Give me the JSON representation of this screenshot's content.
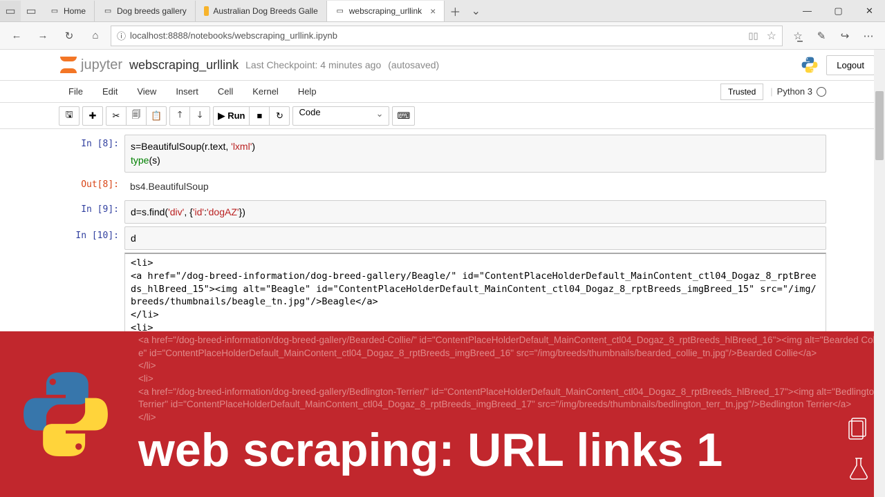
{
  "tabs": [
    {
      "label": "Home"
    },
    {
      "label": "Dog breeds gallery"
    },
    {
      "label": "Australian Dog Breeds Galle"
    },
    {
      "label": "webscraping_urllink",
      "active": true
    }
  ],
  "url": "localhost:8888/notebooks/webscraping_urllink.ipynb",
  "jupyter": {
    "logo_text": "jupyter",
    "notebook_name": "webscraping_urllink",
    "checkpoint": "Last Checkpoint: 4 minutes ago",
    "autosaved": "(autosaved)",
    "logout": "Logout",
    "trusted": "Trusted",
    "kernel": "Python 3"
  },
  "menu": [
    "File",
    "Edit",
    "View",
    "Insert",
    "Cell",
    "Kernel",
    "Help"
  ],
  "toolbar": {
    "run": "Run",
    "cell_type": "Code"
  },
  "cells": {
    "in8_prompt": "In [8]:",
    "in8_code_a": "s=BeautifulSoup(r.text, ",
    "in8_code_str": "'lxml'",
    "in8_code_b": ")\n",
    "in8_type": "type",
    "in8_paren": "(s)",
    "out8_prompt": "Out[8]:",
    "out8_val": "bs4.BeautifulSoup",
    "in9_prompt": "In [9]:",
    "in9_a": "d=s.find(",
    "in9_s1": "'div'",
    "in9_c": ", {",
    "in9_s2": "'id'",
    "in9_col": ":",
    "in9_s3": "'dogAZ'",
    "in9_e": "})",
    "in10_prompt": "In [10]:",
    "in10_code": "d",
    "out10_html": "<li>\n<a href=\"/dog-breed-information/dog-breed-gallery/Beagle/\" id=\"ContentPlaceHolderDefault_MainContent_ctl04_Dogaz_8_rptBreeds_hlBreed_15\"><img alt=\"Beagle\" id=\"ContentPlaceHolderDefault_MainContent_ctl04_Dogaz_8_rptBreeds_imgBreed_15\" src=\"/img/breeds/thumbnails/beagle_tn.jpg\"/>Beagle</a>\n</li>\n<li>"
  },
  "banner": {
    "code": "<a href=\"/dog-breed-information/dog-breed-gallery/Bearded-Collie/\" id=\"ContentPlaceHolderDefault_MainContent_ctl04_Dogaz_8_rptBreeds_hlBreed_16\"><img alt=\"Bearded Collie\" id=\"ContentPlaceHolderDefault_MainContent_ctl04_Dogaz_8_rptBreeds_imgBreed_16\" src=\"/img/breeds/thumbnails/bearded_collie_tn.jpg\"/>Bearded Collie</a>\n</li>\n<li>\n<a href=\"/dog-breed-information/dog-breed-gallery/Bedlington-Terrier/\" id=\"ContentPlaceHolderDefault_MainContent_ctl04_Dogaz_8_rptBreeds_hlBreed_17\"><img alt=\"Bedlington Terrier\" id=\"ContentPlaceHolderDefault_MainContent_ctl04_Dogaz_8_rptBreeds_imgBreed_17\" src=\"/img/breeds/thumbnails/bedlington_terr_tn.jpg\"/>Bedlington Terrier</a>\n</li>",
    "title": "web scraping: URL links 1"
  }
}
